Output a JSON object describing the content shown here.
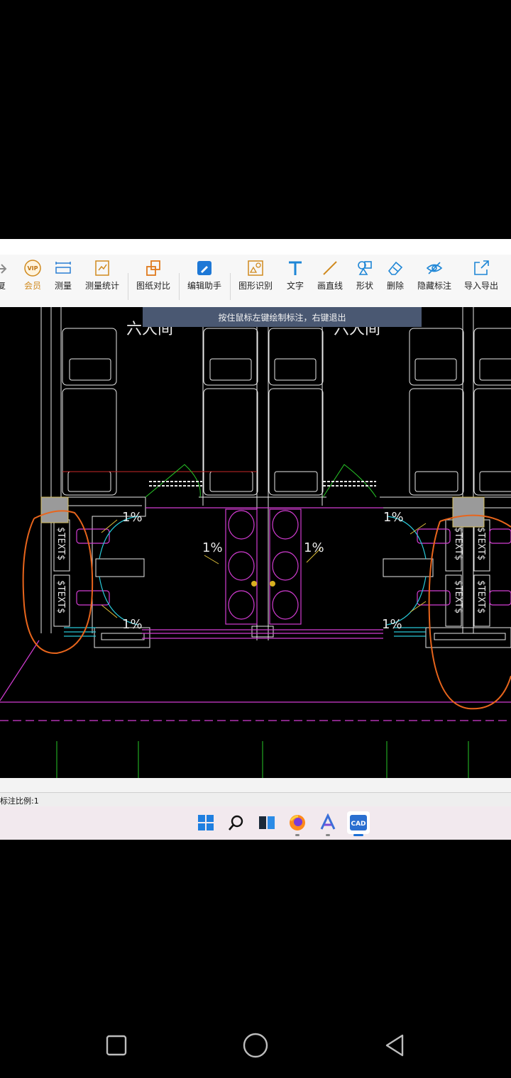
{
  "toolbar": {
    "items": [
      {
        "label": "复",
        "icon": "redo-icon"
      },
      {
        "label": "会员",
        "icon": "vip-icon"
      },
      {
        "label": "测量",
        "icon": "ruler-icon"
      },
      {
        "label": "测量统计",
        "icon": "measure-stats-icon"
      },
      {
        "label": "图纸对比",
        "icon": "compare-icon"
      },
      {
        "label": "编辑助手",
        "icon": "edit-assistant-icon"
      },
      {
        "label": "图形识别",
        "icon": "shape-recognition-icon"
      },
      {
        "label": "文字",
        "icon": "text-icon"
      },
      {
        "label": "画直线",
        "icon": "line-icon"
      },
      {
        "label": "形状",
        "icon": "shapes-icon"
      },
      {
        "label": "删除",
        "icon": "eraser-icon"
      },
      {
        "label": "隐藏标注",
        "icon": "hide-eye-icon"
      },
      {
        "label": "导入导出",
        "icon": "import-export-icon"
      }
    ],
    "vip_badge": "VIP"
  },
  "canvas": {
    "tooltip": "按住鼠标左键绘制标注，右键退出",
    "room_labels": [
      "六人间",
      "六人间"
    ],
    "slope_labels": [
      "1%",
      "1%",
      "1%",
      "1%",
      "1%",
      "1%"
    ],
    "text_tags": [
      "$TEXT$",
      "$TEXT$",
      "$TEXT$",
      "$TEXT$",
      "$TEXT$",
      "$TEXT$"
    ],
    "colors": {
      "background": "#000000",
      "annotation": "#e8651c",
      "magenta": "#d23cd2",
      "cyan": "#28c8d8",
      "green": "#28c828",
      "selection": "#9a9a9a"
    }
  },
  "status": {
    "text": "标注比例:1"
  },
  "taskbar": {
    "items": [
      {
        "name": "windows-start-icon"
      },
      {
        "name": "search-icon"
      },
      {
        "name": "task-view-icon"
      },
      {
        "name": "firefox-icon"
      },
      {
        "name": "app-a-icon"
      },
      {
        "name": "cad-app-icon",
        "label": "CAD"
      }
    ]
  },
  "navbar": {
    "buttons": [
      "recent-apps-button",
      "home-button",
      "back-button"
    ]
  }
}
